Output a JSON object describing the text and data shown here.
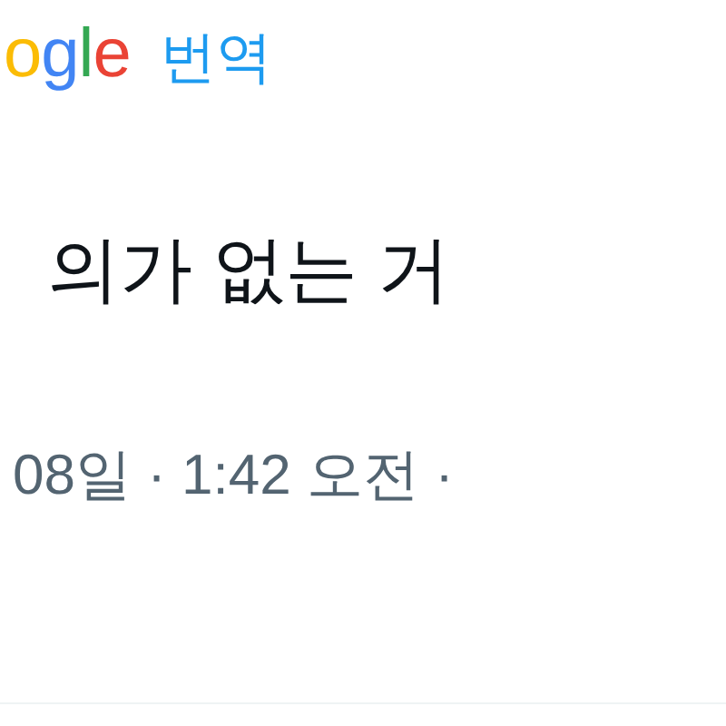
{
  "translate_header": {
    "logo_letters": [
      {
        "char": "o",
        "color": "#fbbc05"
      },
      {
        "char": "g",
        "color": "#4285f4"
      },
      {
        "char": "l",
        "color": "#34a853"
      },
      {
        "char": "e",
        "color": "#ea4335"
      }
    ],
    "label": "번역"
  },
  "translated_text": "의가 없는 거",
  "timestamp": "08일 · 1:42 오전 ·"
}
